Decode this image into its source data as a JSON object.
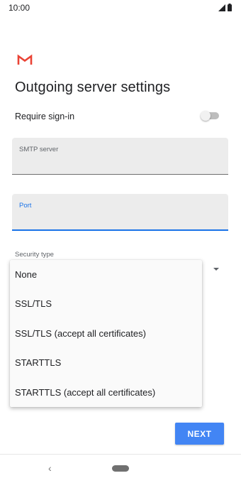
{
  "status_bar": {
    "time": "10:00",
    "icons": [
      "signal-icon",
      "battery-icon"
    ]
  },
  "app": {
    "logo": "gmail-logo-icon",
    "accent_color": "#ea4335"
  },
  "page": {
    "title": "Outgoing server settings"
  },
  "require_signin": {
    "label": "Require sign-in",
    "enabled": false
  },
  "fields": {
    "smtp_server": {
      "label": "SMTP server",
      "value": ""
    },
    "port": {
      "label": "Port",
      "value": "",
      "focused": true
    }
  },
  "security_type": {
    "label": "Security type",
    "options": [
      "None",
      "SSL/TLS",
      "SSL/TLS (accept all certificates)",
      "STARTTLS",
      "STARTTLS (accept all certificates)"
    ]
  },
  "actions": {
    "next_label": "NEXT",
    "next_color": "#4285f4"
  },
  "nav_bar": {
    "back": "‹"
  }
}
